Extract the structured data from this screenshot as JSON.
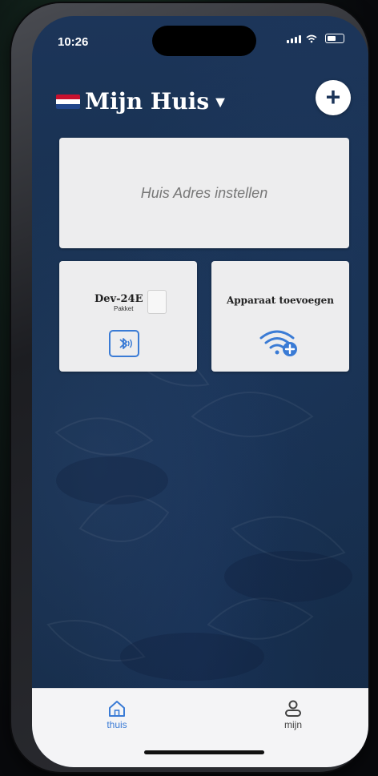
{
  "status_bar": {
    "time": "10:26"
  },
  "header": {
    "title": "Mijn Huis"
  },
  "address_card": {
    "placeholder": "Huis Adres instellen"
  },
  "device": {
    "name": "Dev-24E",
    "subtitle": "Pakket"
  },
  "add_device": {
    "label": "Apparaat toevoegen"
  },
  "tabs": [
    {
      "label": "thuis",
      "icon": "home-icon",
      "active": true
    },
    {
      "label": "mijn",
      "icon": "person-icon",
      "active": false
    }
  ],
  "colors": {
    "accent": "#3a7bd5",
    "background": "#1c3559",
    "card": "#ededee"
  }
}
